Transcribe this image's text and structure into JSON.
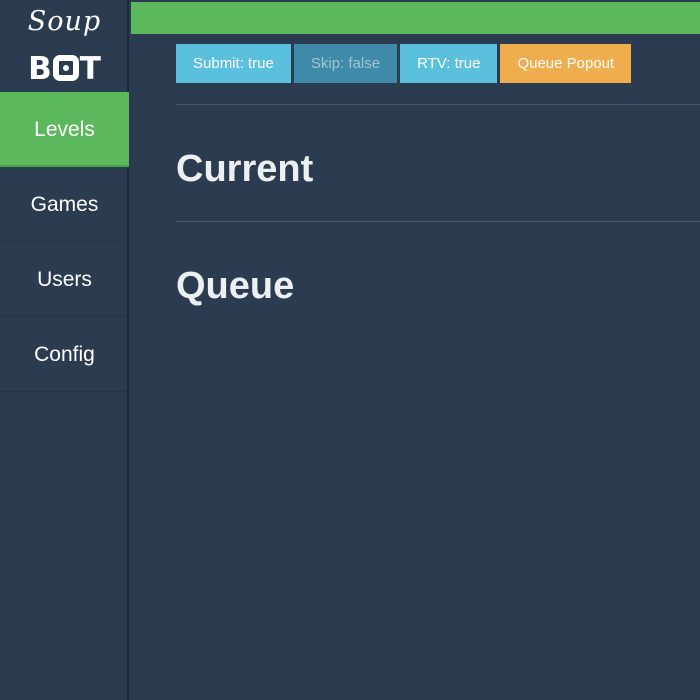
{
  "logo": {
    "script": "Soup",
    "word_left": "B",
    "word_right": "T"
  },
  "sidebar": {
    "items": [
      {
        "label": "Levels",
        "active": true
      },
      {
        "label": "Games",
        "active": false
      },
      {
        "label": "Users",
        "active": false
      },
      {
        "label": "Config",
        "active": false
      }
    ]
  },
  "toolbar": {
    "submit_label": "Submit: true",
    "skip_label": "Skip: false",
    "rtv_label": "RTV: true",
    "queue_popout_label": "Queue Popout"
  },
  "main": {
    "current_heading": "Current",
    "queue_heading": "Queue"
  },
  "colors": {
    "background": "#2b3c50",
    "accent_green": "#5cb85c",
    "info_blue": "#5bc0de",
    "muted_blue": "#3f8aa8",
    "warning_orange": "#f0ad4e"
  }
}
